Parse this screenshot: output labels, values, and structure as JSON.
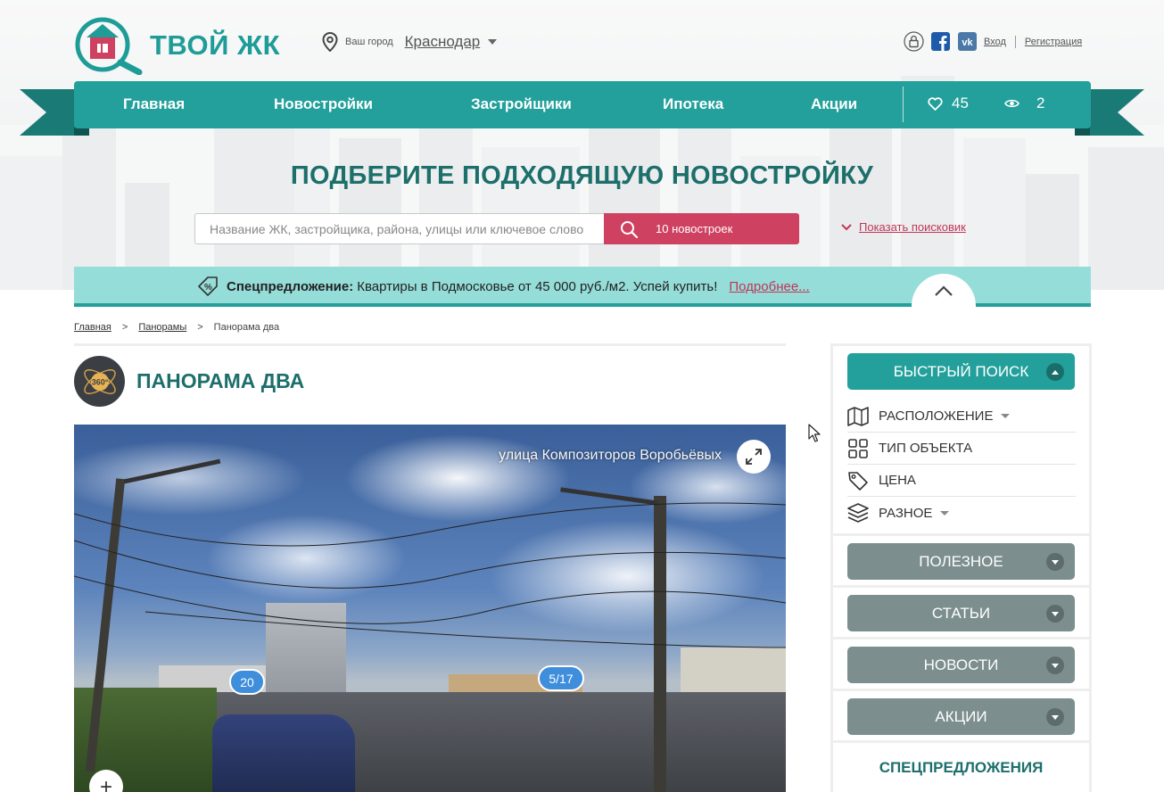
{
  "header": {
    "logo_text": "ТВОЙ ЖК",
    "city_label": "Ваш город",
    "city_value": "Краснодар",
    "login": "Вход",
    "register": "Регистрация"
  },
  "nav": {
    "items": [
      "Главная",
      "Новостройки",
      "Застройщики",
      "Ипотека",
      "Акции"
    ],
    "favorites_count": "45",
    "views_count": "2"
  },
  "hero": {
    "title": "ПОДБЕРИТЕ ПОДХОДЯЩУЮ НОВОСТРОЙКУ",
    "search_placeholder": "Название ЖК, застройщика, района, улицы или ключевое слово",
    "search_button": "10 новостроек",
    "show_search": "Показать поисковик"
  },
  "offer": {
    "label": "Спецпредложение:",
    "text": "Квартиры в Подмосковье от 45 000 руб./м2. Успей купить!",
    "link": "Подробнее..."
  },
  "breadcrumb": [
    "Главная",
    "Панорамы",
    "Панорама два"
  ],
  "page": {
    "title": "ПАНОРАМА ДВА",
    "icon_label": "360°"
  },
  "panorama": {
    "street": "улица Композиторов Воробьёвых",
    "marker_1": "20",
    "marker_2": "5/17"
  },
  "sidebar": {
    "quick_search": "БЫСТРЫЙ ПОИСК",
    "filters": [
      "РАСПОЛОЖЕНИЕ",
      "ТИП ОБЪЕКТА",
      "ЦЕНА",
      "РАЗНОЕ"
    ],
    "sections": [
      "ПОЛЕЗНОЕ",
      "СТАТЬИ",
      "НОВОСТИ",
      "АКЦИИ"
    ],
    "special": "СПЕЦПРЕДЛОЖЕНИЯ"
  },
  "colors": {
    "teal": "#23a09b",
    "dark_teal": "#1c6f6b",
    "crimson": "#cf4160",
    "offer_bg": "#95ddd8"
  }
}
